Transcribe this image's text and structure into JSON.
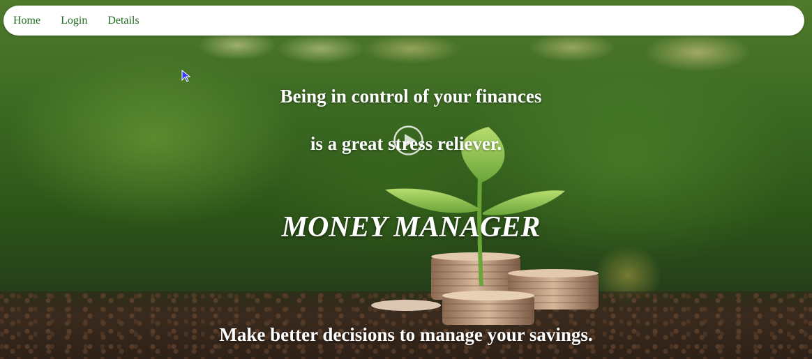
{
  "nav": {
    "items": [
      {
        "label": "Home"
      },
      {
        "label": "Login"
      },
      {
        "label": "Details"
      }
    ]
  },
  "hero": {
    "line1": "Being in control of your finances",
    "line2": "is a great stress reliever.",
    "brand": "MONEY MANAGER",
    "tagline": "Make better decisions to manage your savings."
  },
  "media": {
    "play_icon": "play-circle-icon",
    "cursor_icon": "mouse-pointer-icon",
    "background": "seedling-growing-from-coin-stacks"
  },
  "colors": {
    "nav_link": "#1f6b1f",
    "nav_bg": "#ffffff",
    "hero_text": "#ffffff"
  }
}
